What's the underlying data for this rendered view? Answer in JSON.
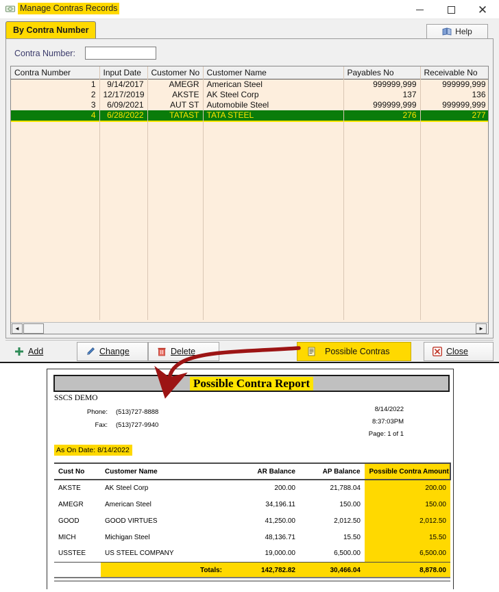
{
  "window": {
    "title": "Manage Contras Records",
    "icon": "money-icon",
    "minimize_label": "—",
    "maximize_label": "□",
    "close_label": "✕"
  },
  "tab": {
    "label": "By Contra Number"
  },
  "help": {
    "label": "Help",
    "icon": "book-icon"
  },
  "search": {
    "label": "Contra Number:",
    "value": "",
    "placeholder": ""
  },
  "grid": {
    "columns": [
      "Contra Number",
      "Input Date",
      "Customer No",
      "Customer Name",
      "Payables No",
      "Receivable No"
    ],
    "rows": [
      {
        "contra_number": "1",
        "input_date": "9/14/2017",
        "customer_no": "AMEGR",
        "customer_name": "American Steel",
        "payables_no": "999999,999",
        "receivable_no": "999999,999",
        "selected": false
      },
      {
        "contra_number": "2",
        "input_date": "12/17/2019",
        "customer_no": "AKSTE",
        "customer_name": "AK Steel Corp",
        "payables_no": "137",
        "receivable_no": "136",
        "selected": false
      },
      {
        "contra_number": "3",
        "input_date": "6/09/2021",
        "customer_no": "AUT ST",
        "customer_name": "Automobile Steel",
        "payables_no": "999999,999",
        "receivable_no": "999999,999",
        "selected": false
      },
      {
        "contra_number": "4",
        "input_date": "6/28/2022",
        "customer_no": "TATAST",
        "customer_name": "TATA STEEL",
        "payables_no": "276",
        "receivable_no": "277",
        "selected": true
      }
    ]
  },
  "scrollbar": {
    "left_arrow": "◄",
    "right_arrow": "►"
  },
  "toolbar": {
    "add_label": "Add",
    "change_label": "Change",
    "delete_label": "Delete",
    "possible_contras_label": "Possible Contras",
    "close_label": "Close"
  },
  "report": {
    "title": "Possible Contra Report",
    "company": "SSCS DEMO",
    "phone_label": "Phone:",
    "phone_value": "(513)727-8888",
    "fax_label": "Fax:",
    "fax_value": "(513)727-9940",
    "date": "8/14/2022",
    "time": "8:37:03PM",
    "page": "Page: 1 of 1",
    "as_on_date": "As On Date:  8/14/2022",
    "columns": [
      "Cust No",
      "Customer Name",
      "AR Balance",
      "AP Balance",
      "Possible Contra Amount"
    ],
    "rows": [
      {
        "cust_no": "AKSTE",
        "customer_name": "AK Steel Corp",
        "ar_balance": "200.00",
        "ap_balance": "21,788.04",
        "possible_contra_amount": "200.00"
      },
      {
        "cust_no": "AMEGR",
        "customer_name": "American Steel",
        "ar_balance": "34,196.11",
        "ap_balance": "150.00",
        "possible_contra_amount": "150.00"
      },
      {
        "cust_no": "GOOD",
        "customer_name": "GOOD VIRTUES",
        "ar_balance": "41,250.00",
        "ap_balance": "2,012.50",
        "possible_contra_amount": "2,012.50"
      },
      {
        "cust_no": "MICH",
        "customer_name": "Michigan Steel",
        "ar_balance": "48,136.71",
        "ap_balance": "15.50",
        "possible_contra_amount": "15.50"
      },
      {
        "cust_no": "USSTEE",
        "customer_name": "US STEEL COMPANY",
        "ar_balance": "19,000.00",
        "ap_balance": "6,500.00",
        "possible_contra_amount": "6,500.00"
      }
    ],
    "totals": {
      "label": "Totals:",
      "ar_balance": "142,782.82",
      "ap_balance": "30,466.04",
      "possible_contra_amount": "8,878.00"
    }
  },
  "colors": {
    "highlight_yellow": "#ffd900",
    "selection_green": "#0a7c0a",
    "selection_text": "#ffe400",
    "grid_background": "#fdeedd",
    "arrow_red": "#9c1414"
  }
}
